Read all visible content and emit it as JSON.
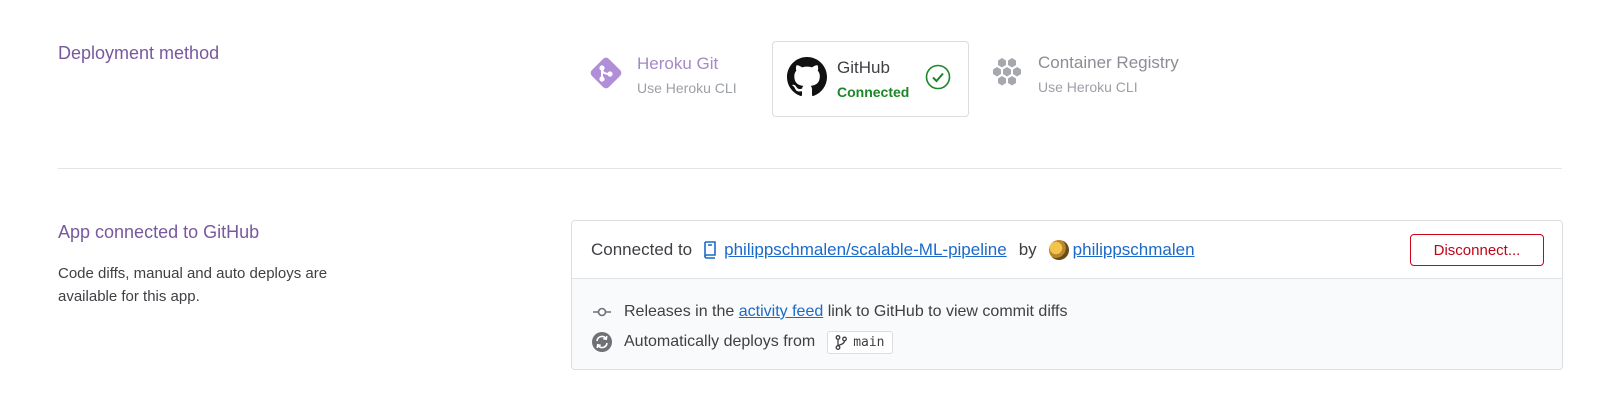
{
  "deployment": {
    "title": "Deployment method",
    "methods": [
      {
        "name": "Heroku Git",
        "sub": "Use Heroku CLI",
        "icon": "heroku-git-icon"
      },
      {
        "name": "GitHub",
        "sub": "Connected",
        "icon": "github-icon",
        "selected": true
      },
      {
        "name": "Container Registry",
        "sub": "Use Heroku CLI",
        "icon": "container-registry-icon"
      }
    ]
  },
  "connected": {
    "title": "App connected to GitHub",
    "desc": "Code diffs, manual and auto deploys are available for this app.",
    "connected_to": "Connected to",
    "repo": "philippschmalen/scalable-ML-pipeline",
    "by": "by",
    "user": "philippschmalen",
    "disconnect_label": "Disconnect...",
    "releases_prefix": "Releases in the",
    "activity_feed": "activity feed",
    "releases_suffix": "link to GitHub to view commit diffs",
    "auto_deploy": "Automatically deploys from",
    "branch": "main"
  },
  "colors": {
    "accent": "#79589f",
    "link": "#1b6ac9",
    "success": "#1b8728",
    "danger": "#c00418"
  }
}
